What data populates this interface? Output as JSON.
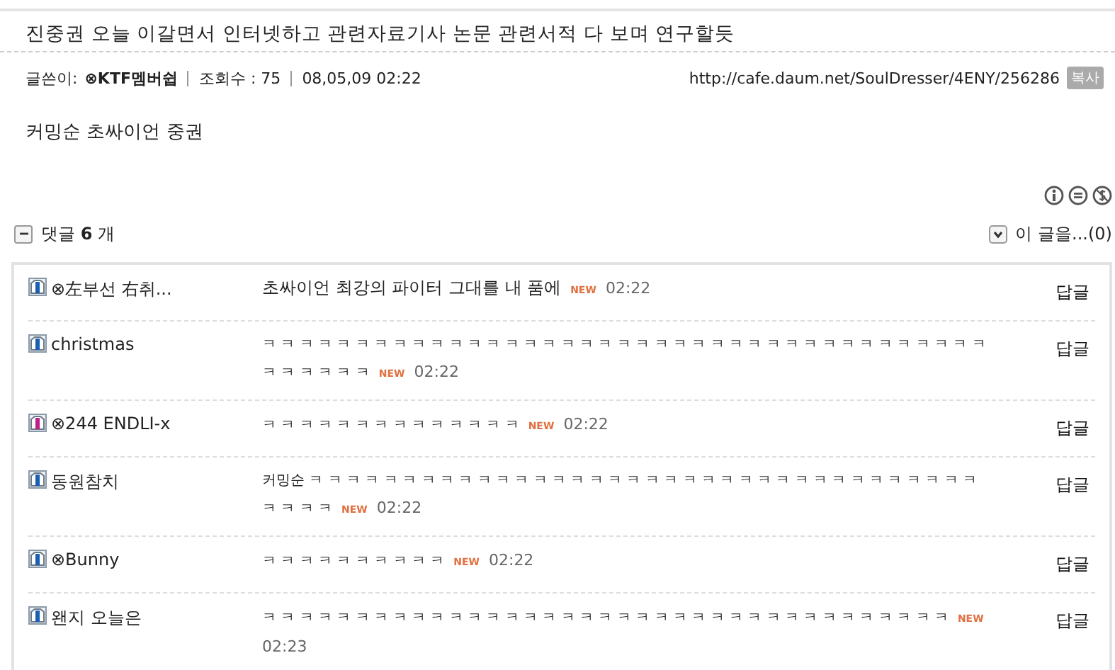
{
  "post": {
    "title": "진중권 오늘 이갈면서 인터넷하고 관련자료기사 논문 관련서적 다 보며 연구할듯",
    "author_label": "글쓴이:",
    "author": "⊗KTF멤버쉽",
    "views_label": "조회수 : 75",
    "date": "08,05,09 02:22",
    "url": "http://cafe.daum.net/SoulDresser/4ENY/256286",
    "copy_button": "복사",
    "body": "커밍순 초싸이언 중권"
  },
  "comments_header": {
    "expanded": true,
    "label_prefix": "댓글",
    "count": "6",
    "label_suffix": "개",
    "related": "이 글을...(0)"
  },
  "comments": [
    {
      "author": "⊗左부선 右취...",
      "color": "#1a5fb4",
      "lines": [
        "초싸이언 최강의 파이터 그대를 내 품에"
      ],
      "new_label": "NEW",
      "time": "02:22",
      "reply": "답글"
    },
    {
      "author": "christmas",
      "color": "#1a5fb4",
      "lines": [
        "ㅋ ㅋ ㅋ ㅋ ㅋ ㅋ ㅋ ㅋ ㅋ ㅋ ㅋ ㅋ ㅋ ㅋ ㅋ ㅋ ㅋ ㅋ ㅋ ㅋ ㅋ ㅋ ㅋ ㅋ ㅋ ㅋ ㅋ ㅋ ㅋ ㅋ ㅋ ㅋ ㅋ ㅋ ㅋ ㅋ ㅋ ㅋ ㅋ",
        "ㅋ ㅋ ㅋ ㅋ ㅋ ㅋ"
      ],
      "new_label": "NEW",
      "time": "02:22",
      "reply": "답글"
    },
    {
      "author": "⊗244 ENDLI-x",
      "color": "#c0208a",
      "lines": [
        "ㅋ ㅋ ㅋ ㅋ ㅋ ㅋ ㅋ ㅋ ㅋ ㅋ ㅋ ㅋ ㅋ ㅋ"
      ],
      "new_label": "NEW",
      "time": "02:22",
      "reply": "답글"
    },
    {
      "author": "동원참치",
      "color": "#1a5fb4",
      "lines": [
        "커밍순 ㅋ ㅋ ㅋ ㅋ ㅋ ㅋ ㅋ ㅋ ㅋ ㅋ ㅋ ㅋ ㅋ ㅋ ㅋ ㅋ ㅋ ㅋ ㅋ ㅋ ㅋ ㅋ ㅋ ㅋ ㅋ ㅋ ㅋ ㅋ ㅋ ㅋ ㅋ ㅋ ㅋ ㅋ ㅋ ㅋ",
        "ㅋ ㅋ ㅋ ㅋ"
      ],
      "new_label": "NEW",
      "time": "02:22",
      "reply": "답글"
    },
    {
      "author": "⊗Bunny",
      "color": "#1a5fb4",
      "lines": [
        "ㅋ ㅋ ㅋ ㅋ ㅋ ㅋ ㅋ ㅋ ㅋ ㅋ"
      ],
      "new_label": "NEW",
      "time": "02:22",
      "reply": "답글"
    },
    {
      "author": "왠지 오늘은",
      "color": "#1a5fb4",
      "lines": [
        "ㅋ ㅋ ㅋ ㅋ ㅋ ㅋ ㅋ ㅋ ㅋ ㅋ ㅋ ㅋ ㅋ ㅋ ㅋ ㅋ ㅋ ㅋ ㅋ ㅋ ㅋ ㅋ ㅋ ㅋ ㅋ ㅋ ㅋ ㅋ ㅋ ㅋ ㅋ ㅋ ㅋ ㅋ ㅋ ㅋ ㅋ"
      ],
      "new_label": "NEW",
      "time": "02:23",
      "reply": "답글"
    }
  ]
}
